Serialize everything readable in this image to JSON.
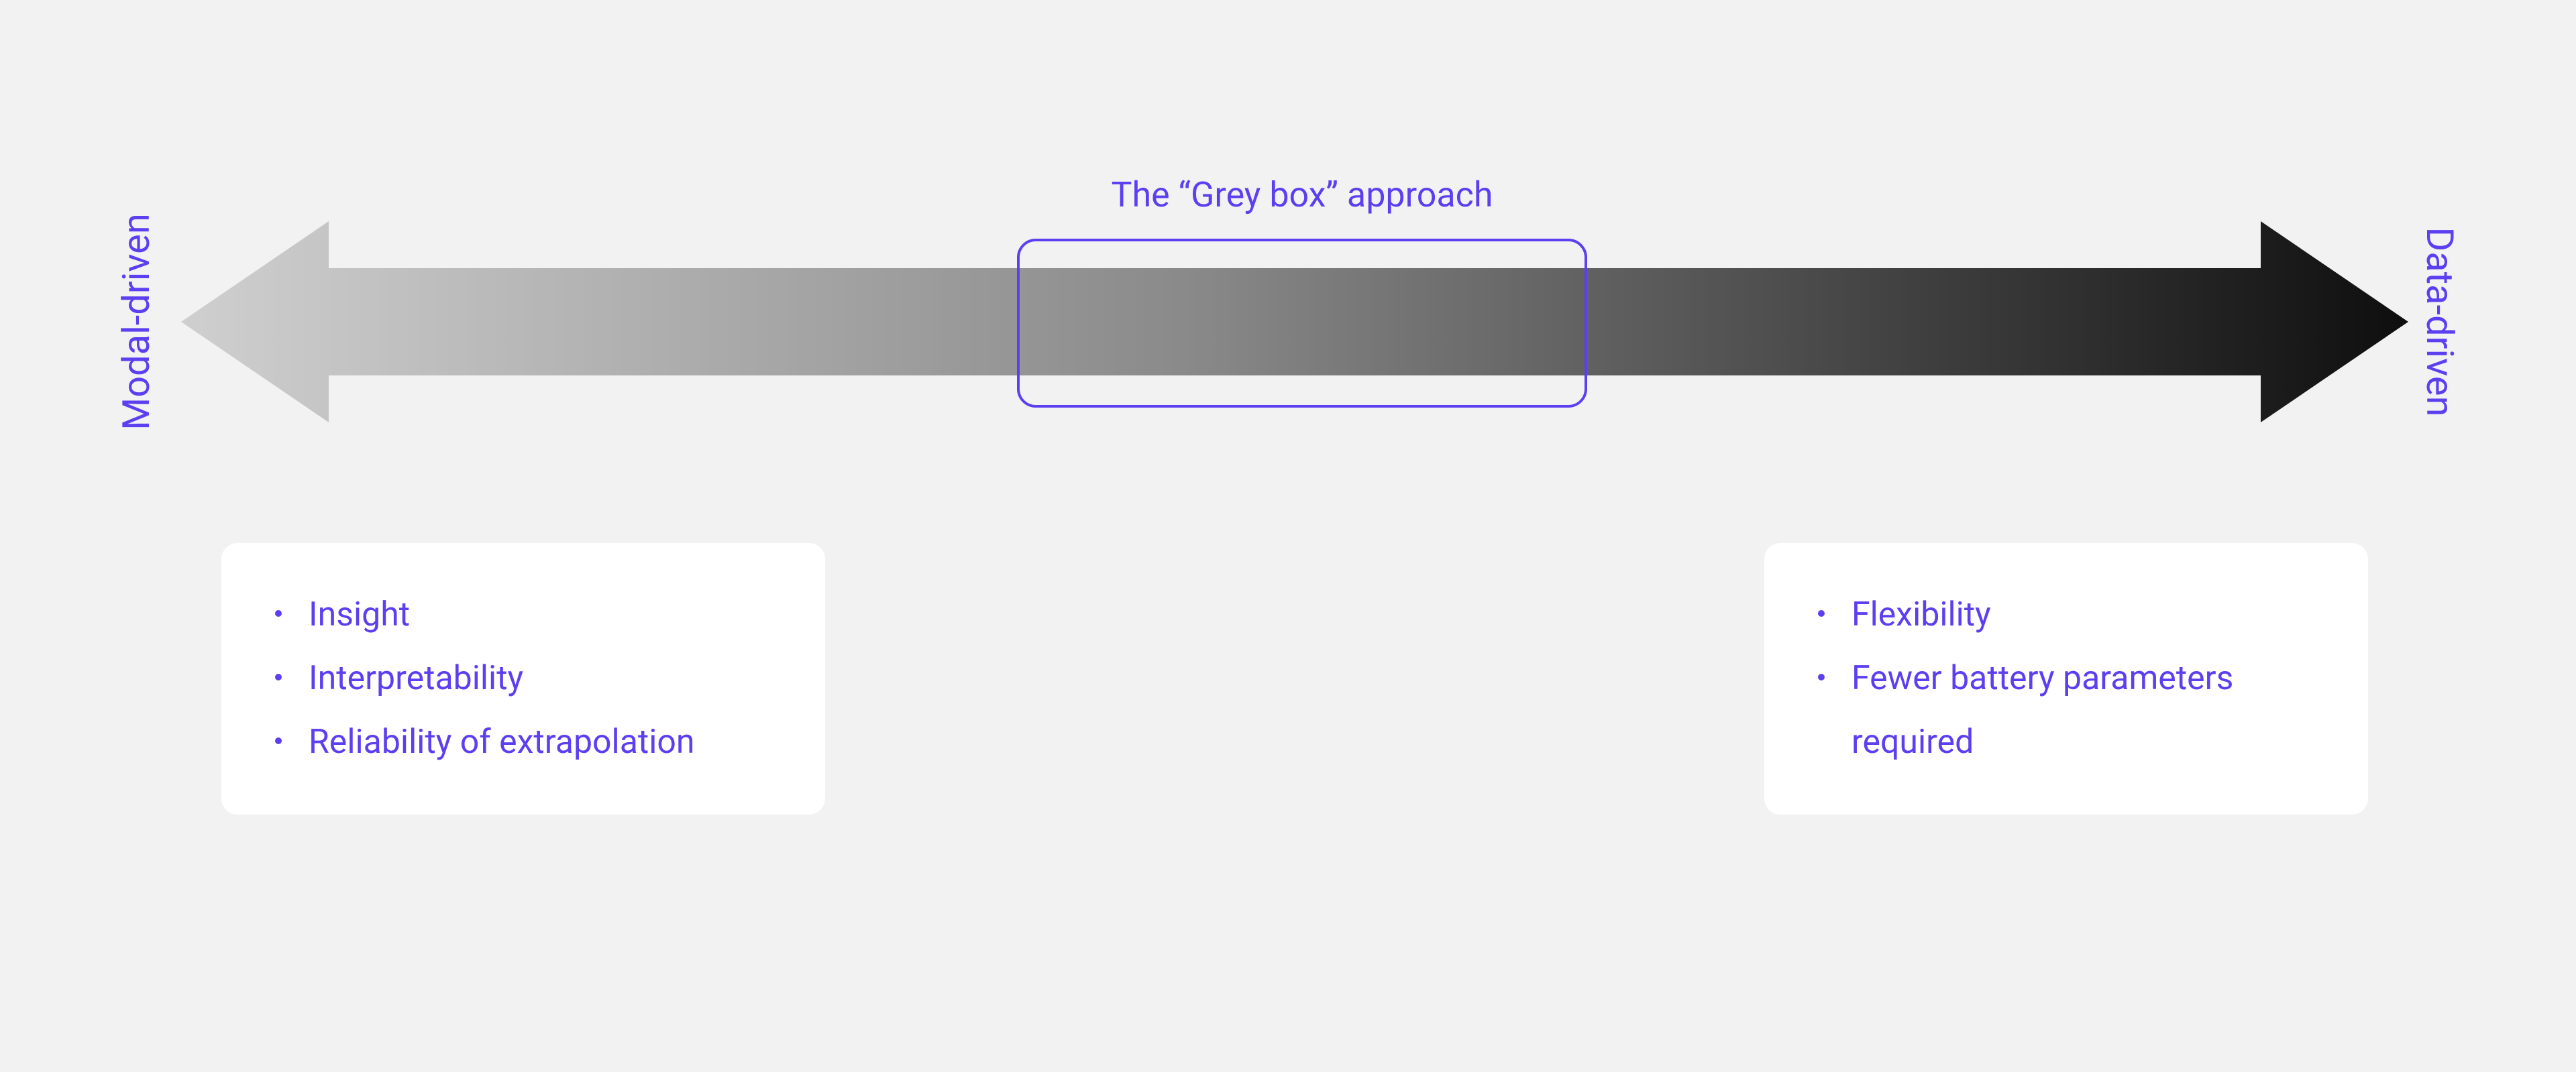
{
  "greybox": {
    "label": "The “Grey box” approach"
  },
  "spectrum": {
    "left_label": "Modal-driven",
    "right_label": "Data-driven"
  },
  "left_card": {
    "items": [
      "Insight",
      "Interpretability",
      "Reliability of extrapolation"
    ]
  },
  "right_card": {
    "items": [
      "Flexibility",
      "Fewer battery parameters required"
    ]
  },
  "colors": {
    "accent": "#5b3ff0",
    "arrow_light": "#cfcfcf",
    "arrow_dark": "#0e0e0e",
    "background": "#f2f2f2",
    "card_bg": "#ffffff"
  }
}
